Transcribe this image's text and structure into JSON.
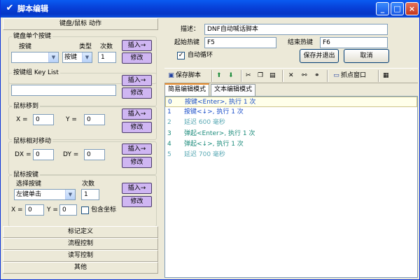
{
  "window": {
    "title": "脚本编辑",
    "min": "_",
    "max": "□",
    "close": "×"
  },
  "left": {
    "header": "键盘/鼠标 动作",
    "g1": {
      "label": "键盘单个按键",
      "key_lbl": "按键",
      "type_lbl": "类型",
      "count_lbl": "次数",
      "key_val": "",
      "type_val": "按键",
      "count_val": "1",
      "insert": "插入→",
      "modify": "修改"
    },
    "g2": {
      "label": "按键组 Key List",
      "value": "",
      "insert": "插入→",
      "modify": "修改"
    },
    "g3": {
      "label": "鼠标移到",
      "x_lbl": "X =",
      "x_val": "0",
      "y_lbl": "Y =",
      "y_val": "0",
      "insert": "插入→",
      "modify": "修改"
    },
    "g4": {
      "label": "鼠标相对移动",
      "dx_lbl": "DX =",
      "dx_val": "0",
      "dy_lbl": "DY =",
      "dy_val": "0",
      "insert": "插入→",
      "modify": "修改"
    },
    "g5": {
      "label": "鼠标按键",
      "sel_lbl": "选择按键",
      "count_lbl": "次数",
      "sel_val": "左键单击",
      "count_val": "1",
      "x_lbl": "X =",
      "x_val": "0",
      "y_lbl": "Y =",
      "y_val": "0",
      "include_lbl": "包含坐标",
      "insert": "插入→",
      "modify": "修改"
    },
    "sections": [
      "标记定义",
      "流程控制",
      "读写控制",
      "其他"
    ]
  },
  "right": {
    "desc_lbl": "描述：",
    "desc_val": "DNF自动喊话脚本",
    "start_lbl": "起始热键",
    "start_val": "F5",
    "end_lbl": "结束热键",
    "end_val": "F6",
    "loop_lbl": "自动循环",
    "loop_checked": "✓",
    "save_exit": "保存并退出",
    "cancel": "取消",
    "toolbar": {
      "save": "保存脚本",
      "capture": "抓点窗口"
    },
    "tabs": [
      "简易编辑模式",
      "文本编辑模式"
    ],
    "lines": [
      {
        "n": "0",
        "t": "按键<Enter>, 执行 1 次",
        "color": "#1a4ec9"
      },
      {
        "n": "1",
        "t": "按键<↓>, 执行 1 次",
        "color": "#1a4ec9"
      },
      {
        "n": "2",
        "t": "延迟 600 毫秒",
        "color": "#5aa9b4"
      },
      {
        "n": "3",
        "t": "弹起<Enter>, 执行 1 次",
        "color": "#1a8a7a"
      },
      {
        "n": "4",
        "t": "弹起<↓>, 执行 1 次",
        "color": "#1a8a7a"
      },
      {
        "n": "5",
        "t": "延迟 700 毫秒",
        "color": "#5aa9b4"
      }
    ]
  }
}
